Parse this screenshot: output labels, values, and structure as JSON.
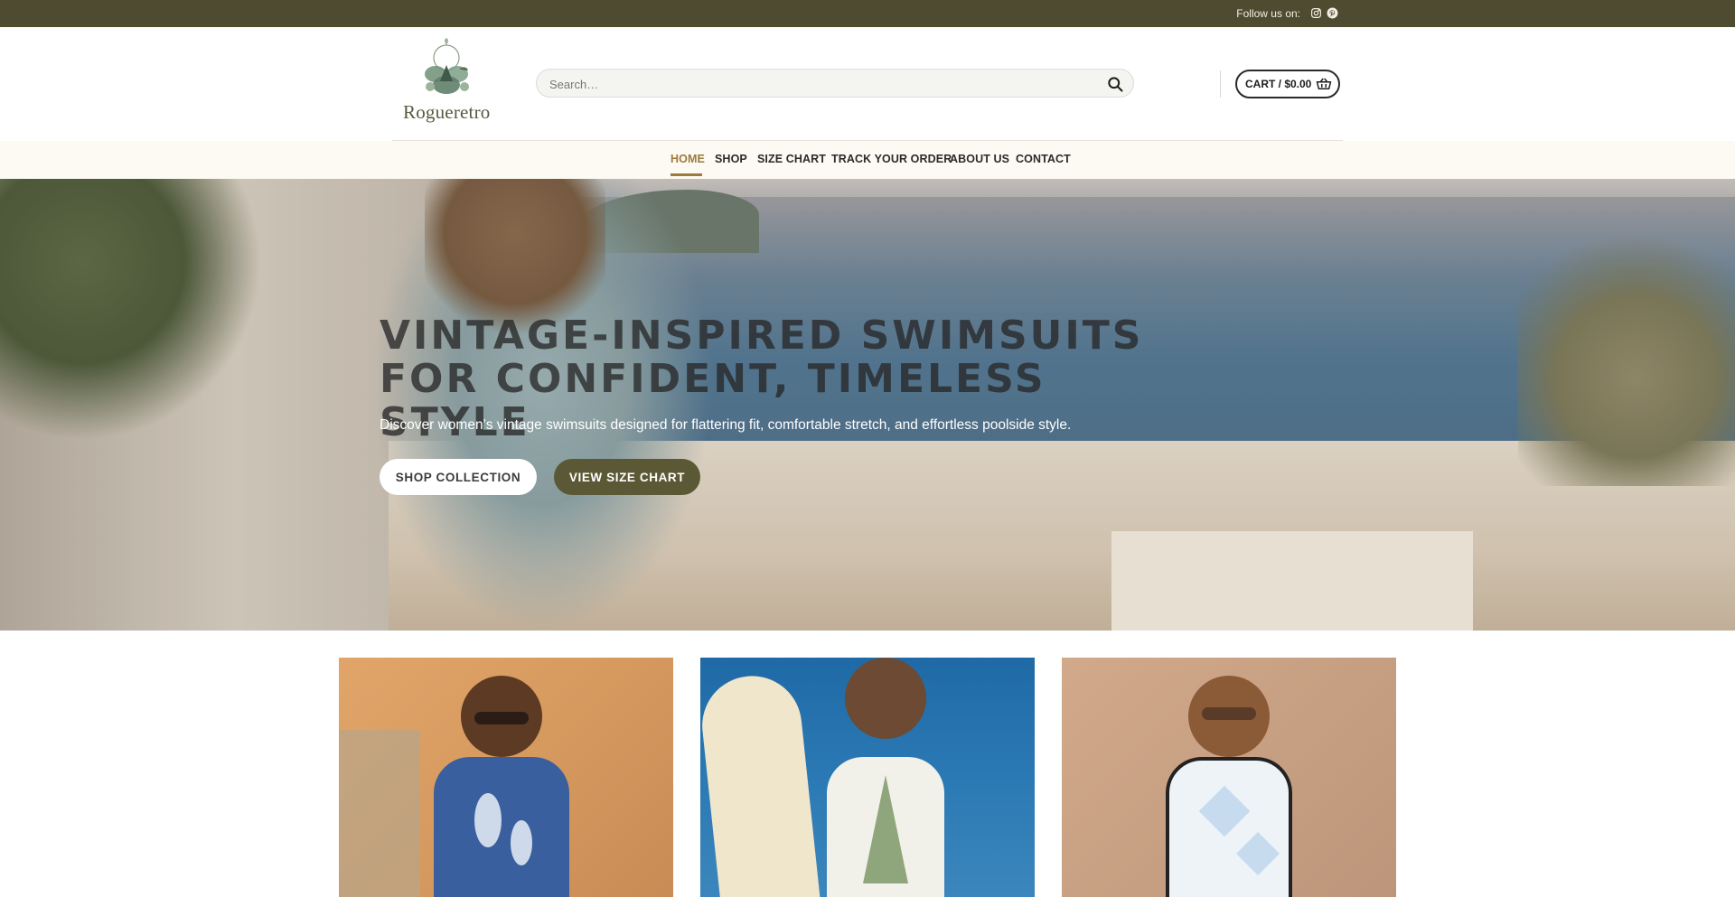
{
  "topbar": {
    "follow_label": "Follow us on:",
    "social_icons": [
      "instagram-icon",
      "pinterest-icon"
    ],
    "background": "#4f4b30"
  },
  "header": {
    "logo_text": "Rogueretro",
    "search": {
      "placeholder": "Search…"
    },
    "cart": {
      "label": "CART / $0.00"
    }
  },
  "nav": {
    "items": [
      {
        "label": "HOME",
        "active": true
      },
      {
        "label": "SHOP"
      },
      {
        "label": "SIZE CHART"
      },
      {
        "label": "TRACK YOUR ORDER"
      },
      {
        "label": "ABOUT US"
      },
      {
        "label": "CONTACT"
      }
    ],
    "accent": "#9a7b3c"
  },
  "hero": {
    "title_line1": "VINTAGE-INSPIRED SWIMSUITS",
    "title_line2": "FOR CONFIDENT, TIMELESS STYLE",
    "subtitle": "Discover women’s vintage swimsuits designed for flattering fit, comfortable stretch, and effortless poolside style.",
    "buttons": [
      {
        "label": "SHOP COLLECTION"
      },
      {
        "label": "VIEW SIZE CHART"
      }
    ],
    "button_accent": "#5b5935"
  },
  "products": [
    {
      "image": "woman-in-blue-floral-swimsuit"
    },
    {
      "image": "woman-with-surfboard-in-white-swimsuit"
    },
    {
      "image": "woman-in-argyle-swimsuit"
    }
  ]
}
